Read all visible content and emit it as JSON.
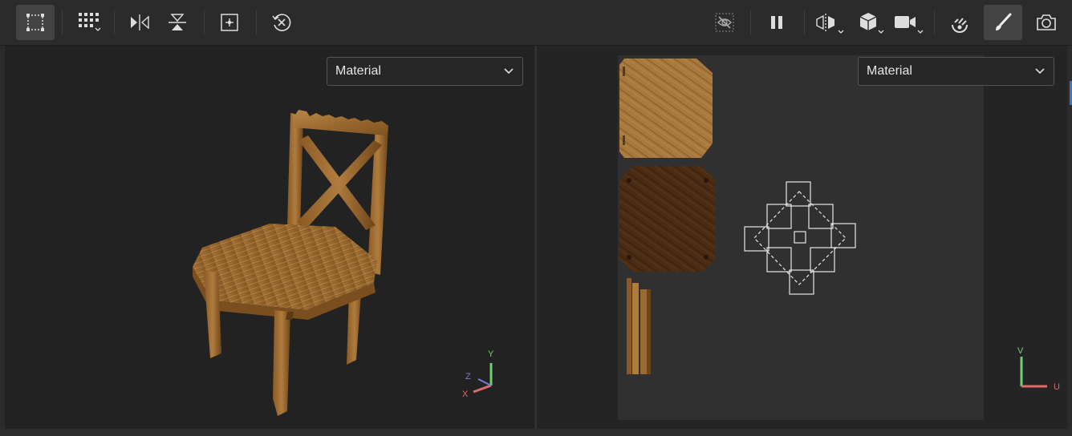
{
  "toolbar": {
    "left_tools": [
      {
        "name": "select-box-tool",
        "active": true
      },
      {
        "name": "grid-tool",
        "dropdown": true
      },
      {
        "name": "mirror-horizontal-tool"
      },
      {
        "name": "mirror-vertical-tool"
      },
      {
        "name": "focus-tool"
      },
      {
        "name": "reset-tool"
      }
    ],
    "right_tools": [
      {
        "name": "hide-visibility-tool"
      },
      {
        "name": "pause-tool"
      },
      {
        "name": "symmetry-tool",
        "dropdown": true
      },
      {
        "name": "cube-view-tool",
        "dropdown": true
      },
      {
        "name": "camera-tool",
        "dropdown": true
      },
      {
        "name": "lighting-tool"
      },
      {
        "name": "paint-brush-tool",
        "active": true
      },
      {
        "name": "screenshot-tool"
      }
    ]
  },
  "left_viewport": {
    "shading_mode": "Material",
    "axes": {
      "y": "Y",
      "z": "Z",
      "x": "X"
    }
  },
  "right_viewport": {
    "shading_mode": "Material",
    "axes": {
      "v": "V",
      "u": "U"
    }
  },
  "colors": {
    "accent": "#2c7bd0",
    "wood_light": "#a8783c",
    "wood_dark": "#4a2c14",
    "axis_y": "#6fd06f",
    "axis_x": "#e06a6a",
    "axis_z": "#7c7cd8"
  }
}
